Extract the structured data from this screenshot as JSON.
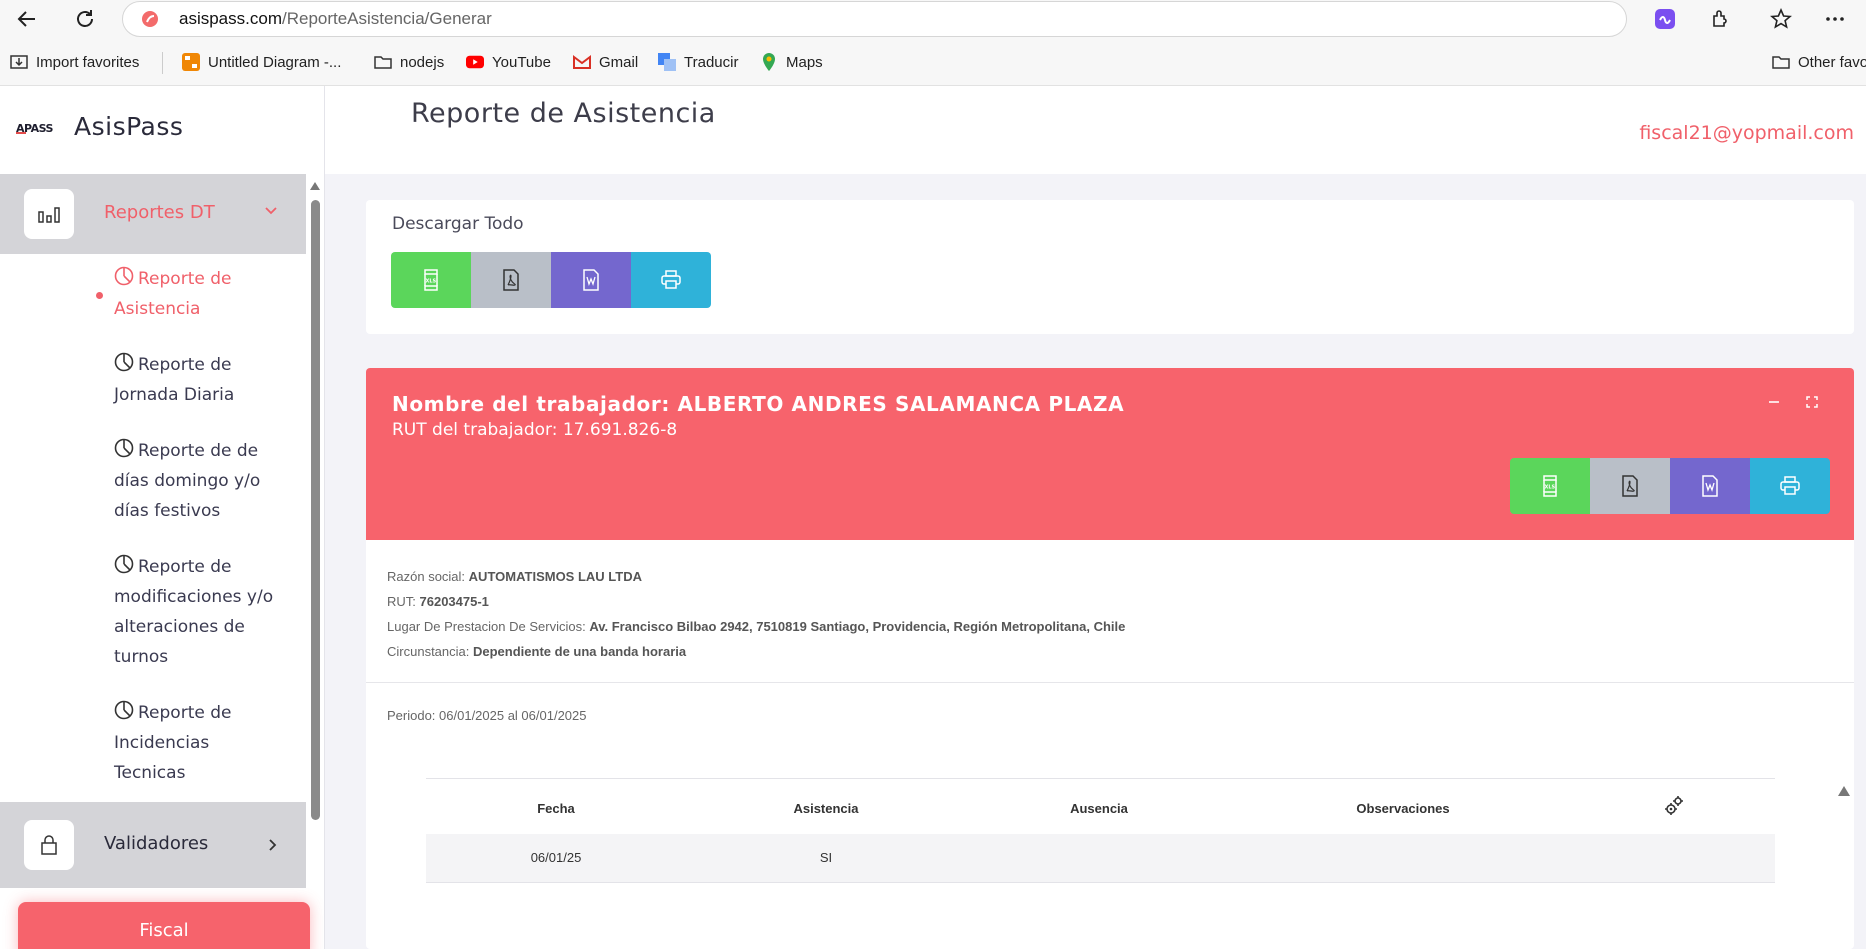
{
  "browser": {
    "url_host": "asispass.com",
    "url_path": "/ReporteAsistencia/Generar",
    "bookmarks": [
      {
        "label": "Import favorites",
        "icon": "import-icon"
      },
      {
        "label": "Untitled Diagram -...",
        "icon": "drawio-icon"
      },
      {
        "label": "nodejs",
        "icon": "folder-icon"
      },
      {
        "label": "YouTube",
        "icon": "youtube-icon"
      },
      {
        "label": "Gmail",
        "icon": "gmail-icon"
      },
      {
        "label": "Traducir",
        "icon": "translate-icon"
      },
      {
        "label": "Maps",
        "icon": "maps-icon"
      },
      {
        "label": "Other favo",
        "icon": "folder-icon"
      }
    ]
  },
  "sidebar": {
    "logo_mark": "APASS",
    "app_name": "AsisPass",
    "groups": [
      {
        "label": "Reportes DT",
        "icon": "bar-chart-icon",
        "expanded": true,
        "items": [
          {
            "label": "Reporte de Asistencia",
            "icon": "pie-chart-icon",
            "active": true
          },
          {
            "label": "Reporte de Jornada Diaria",
            "icon": "pie-chart-icon",
            "active": false
          },
          {
            "label": "Reporte de de días domingo y/o días festivos",
            "icon": "pie-chart-icon",
            "active": false
          },
          {
            "label": "Reporte de modificaciones y/o alteraciones de turnos",
            "icon": "pie-chart-icon",
            "active": false
          },
          {
            "label": "Reporte de Incidencias Tecnicas",
            "icon": "pie-chart-icon",
            "active": false
          }
        ]
      },
      {
        "label": "Validadores",
        "icon": "lock-icon",
        "expanded": false
      }
    ],
    "footer_button": "Fiscal"
  },
  "header": {
    "title": "Reporte de Asistencia",
    "user_email": "fiscal21@yopmail.com"
  },
  "download_all": {
    "title": "Descargar Todo",
    "buttons": [
      "xls",
      "pdf",
      "word",
      "print"
    ]
  },
  "worker": {
    "name_line": "Nombre del trabajador: ALBERTO ANDRES SALAMANCA PLAZA",
    "rut_line": "RUT del trabajador: 17.691.826-8",
    "razon_social_label": "Razón social:",
    "razon_social": "AUTOMATISMOS LAU LTDA",
    "rut_label": "RUT:",
    "rut": "76203475-1",
    "lugar_label": "Lugar De Prestacion De Servicios:",
    "lugar": "Av. Francisco Bilbao 2942, 7510819 Santiago, Providencia, Región Metropolitana, Chile",
    "circunstancia_label": "Circunstancia:",
    "circunstancia": "Dependiente de una banda horaria",
    "periodo": "Periodo: 06/01/2025 al 06/01/2025"
  },
  "table": {
    "columns": [
      "Fecha",
      "Asistencia",
      "Ausencia",
      "Observaciones"
    ],
    "rows": [
      {
        "fecha": "06/01/25",
        "asistencia": "SI",
        "ausencia": "",
        "observaciones": ""
      }
    ]
  },
  "colors": {
    "accent": "#f6636c",
    "xls": "#5bd65b",
    "pdf": "#b9bfc8",
    "word": "#7467ce",
    "print": "#2fb2d9"
  }
}
